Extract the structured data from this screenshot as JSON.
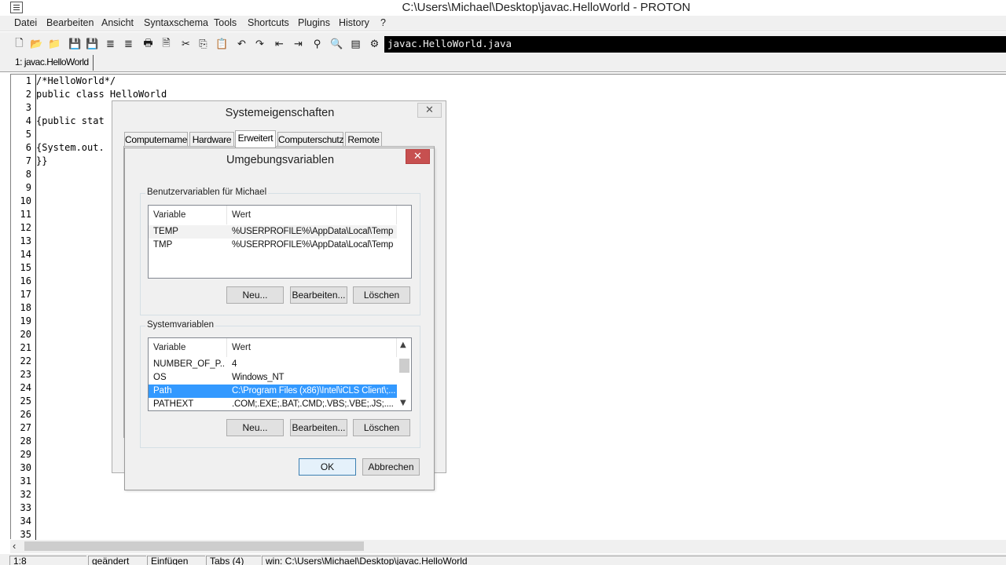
{
  "window": {
    "title": "C:\\Users\\Michael\\Desktop\\javac.HelloWorld - PROTON"
  },
  "menu": [
    "Datei",
    "Bearbeiten",
    "Ansicht",
    "Syntaxschema",
    "Tools",
    "Shortcuts",
    "Plugins",
    "History",
    "?"
  ],
  "toolbar": {
    "icons": [
      "new-file-icon",
      "open-file-icon",
      "open-folder-icon",
      "save-icon",
      "save-all-icon",
      "cut-lines-icon",
      "paste-lines-icon",
      "print-icon",
      "print-preview-icon",
      "cut-icon",
      "copy-icon",
      "paste-icon",
      "undo-icon",
      "redo-icon",
      "outdent-icon",
      "indent-icon",
      "find-icon",
      "search-icon",
      "macro-icon",
      "run-icon"
    ],
    "file_field": "javac.HelloWorld.java"
  },
  "tabs": {
    "active": "1: javac.HelloWorld"
  },
  "editor": {
    "line_numbers": [
      "1",
      "2",
      "3",
      "4",
      "5",
      "6",
      "7",
      "8",
      "9",
      "10",
      "11",
      "12",
      "13",
      "14",
      "15",
      "16",
      "17",
      "18",
      "19",
      "20",
      "21",
      "22",
      "23",
      "24",
      "25",
      "26",
      "27",
      "28",
      "29",
      "30",
      "31",
      "32",
      "33",
      "34",
      "35"
    ],
    "lines": [
      "/*HelloWorld*/",
      "public class HelloWorld",
      "",
      "{public stat",
      "",
      "{System.out.",
      "}}"
    ]
  },
  "statusbar": {
    "position": "1:8",
    "modified": "geändert",
    "mode": "Einfügen",
    "tabs": "Tabs (4)",
    "path": "win: C:\\Users\\Michael\\Desktop\\javac.HelloWorld"
  },
  "system_dialog": {
    "title": "Systemeigenschaften",
    "tabs": [
      "Computername",
      "Hardware",
      "Erweitert",
      "Computerschutz",
      "Remote"
    ],
    "active_tab": "Erweitert"
  },
  "env_dialog": {
    "title": "Umgebungsvariablen",
    "user_group": {
      "label": "Benutzervariablen für Michael",
      "columns": [
        "Variable",
        "Wert"
      ],
      "rows": [
        {
          "variable": "TEMP",
          "value": "%USERPROFILE%\\AppData\\Local\\Temp"
        },
        {
          "variable": "TMP",
          "value": "%USERPROFILE%\\AppData\\Local\\Temp"
        }
      ],
      "buttons": {
        "new": "Neu...",
        "edit": "Bearbeiten...",
        "delete": "Löschen"
      }
    },
    "system_group": {
      "label": "Systemvariablen",
      "columns": [
        "Variable",
        "Wert"
      ],
      "rows": [
        {
          "variable": "NUMBER_OF_P...",
          "value": "4"
        },
        {
          "variable": "OS",
          "value": "Windows_NT"
        },
        {
          "variable": "Path",
          "value": "C:\\Program Files (x86)\\Intel\\iCLS Client\\;..."
        },
        {
          "variable": "PATHEXT",
          "value": ".COM;.EXE;.BAT;.CMD;.VBS;.VBE;.JS;...."
        }
      ],
      "selected_row": "Path",
      "buttons": {
        "new": "Neu...",
        "edit": "Bearbeiten...",
        "delete": "Löschen"
      }
    },
    "ok": "OK",
    "cancel": "Abbrechen"
  }
}
